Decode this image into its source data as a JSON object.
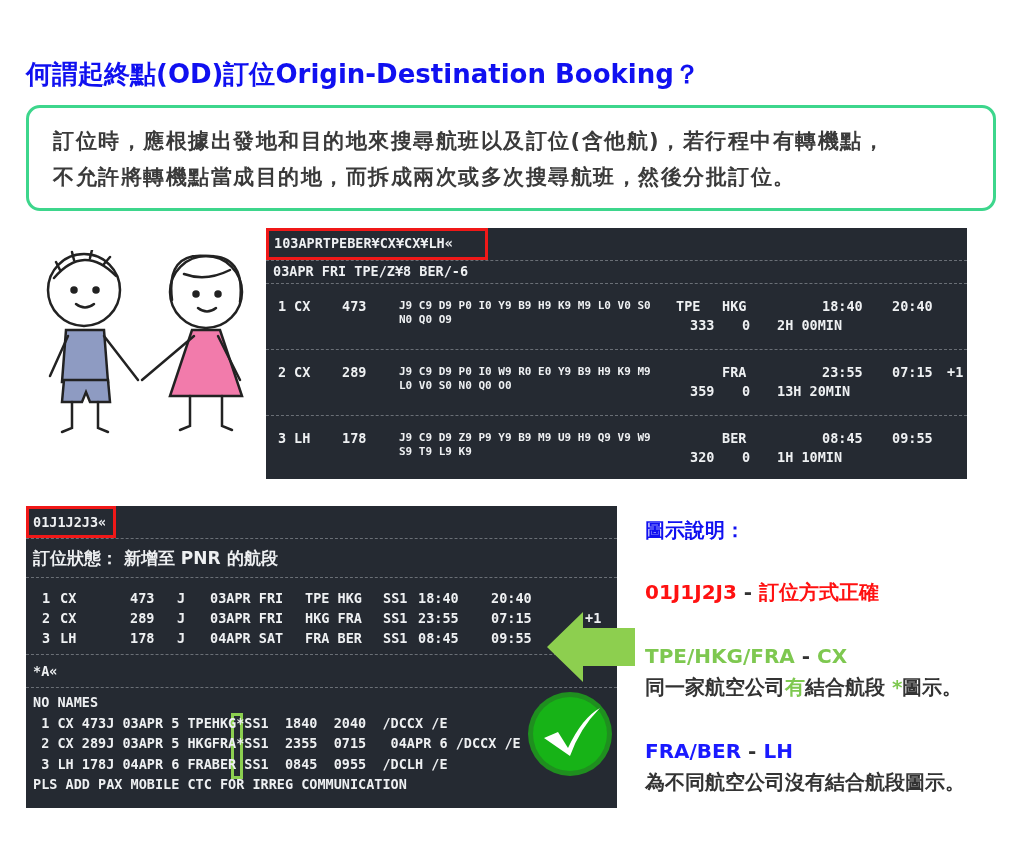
{
  "title": "何謂起終點(OD)訂位Origin-Destination Booking？",
  "intro": [
    "訂位時，應根據出發地和目的地來搜尋航班以及訂位(含他航)，若行程中有轉機點，",
    "不允許將轉機點當成目的地，而拆成兩次或多次搜尋航班，然後分批訂位。"
  ],
  "availability": {
    "command": "103APRTPEBER¥CX¥CX¥LH«",
    "header": "03APR FRI TPE/Z¥8 BER/-6",
    "flights": [
      {
        "line": "1",
        "airline": "CX",
        "flight": "473",
        "classes": [
          "J9 C9 D9 P0 I0 Y9 B9 H9 K9 M9 L0 V0 S0",
          "N0 Q0 O9"
        ],
        "from": "TPE",
        "to": "HKG",
        "depart": "18:40",
        "arrive": "20:40",
        "aircraft": "333",
        "stops": "0",
        "duration": "2H 00MIN"
      },
      {
        "line": "2",
        "airline": "CX",
        "flight": "289",
        "classes": [
          "J9 C9 D9 P0 I0 W9 R0 E0 Y9 B9 H9 K9 M9",
          "L0 V0 S0 N0 Q0 O0"
        ],
        "to": "FRA",
        "depart": "23:55",
        "arrive": "07:15",
        "day_change": "+1",
        "aircraft": "359",
        "stops": "0",
        "duration": "13H 20MIN"
      },
      {
        "line": "3",
        "airline": "LH",
        "flight": "178",
        "classes": [
          "J9 C9 D9 Z9 P9 Y9 B9 M9 U9 H9 Q9 V9 W9",
          "S9 T9 L9 K9"
        ],
        "to": "BER",
        "depart": "08:45",
        "arrive": "09:55",
        "aircraft": "320",
        "stops": "0",
        "duration": "1H 10MIN"
      }
    ]
  },
  "booking": {
    "command": "01J1J2J3«",
    "status": "訂位狀態： 新增至 PNR 的航段",
    "segments": [
      {
        "line": "1",
        "airline": "CX",
        "flight": "473",
        "class": "J",
        "date": "03APR FRI",
        "route": "TPE HKG",
        "status": "SS1",
        "depart": "18:40",
        "arrive": "20:40"
      },
      {
        "line": "2",
        "airline": "CX",
        "flight": "289",
        "class": "J",
        "date": "03APR FRI",
        "route": "HKG FRA",
        "status": "SS1",
        "depart": "23:55",
        "arrive": "07:15",
        "day_change": "+1"
      },
      {
        "line": "3",
        "airline": "LH",
        "flight": "178",
        "class": "J",
        "date": "04APR SAT",
        "route": "FRA BER",
        "status": "SS1",
        "depart": "08:45",
        "arrive": "09:55"
      }
    ],
    "display_command": "*A«",
    "names": "NO NAMES",
    "pnr_lines": [
      "1 CX 473J 03APR 5 TPEHKG*SS1  1840  2040  /DCCX /E",
      "2 CX 289J 03APR 5 HKGFRA*SS1  2355  0715   04APR 6 /DCCX /E",
      "3 LH 178J 04APR 6 FRABER SS1  0845  0955  /DCLH /E"
    ],
    "remark": "PLS ADD PAX MOBILE CTC FOR IRREG COMMUNICATION"
  },
  "legend": {
    "heading": "圖示說明：",
    "items": [
      {
        "code": "01J1J2J3",
        "separator": "-",
        "desc": "訂位方式正確",
        "color": "#ff1111"
      },
      {
        "code": "TPE/HKG/FRA",
        "separator": "-",
        "desc": "CX",
        "color": "#7ec850",
        "note": [
          {
            "text": "同一家航空公司",
            "highlight": false
          },
          {
            "text": "有",
            "highlight": true
          },
          {
            "text": "結合航段 ",
            "highlight": false
          },
          {
            "text": "*",
            "highlight": true
          },
          {
            "text": "圖示。",
            "highlight": false
          }
        ]
      },
      {
        "code": "FRA/BER",
        "separator": "-",
        "desc": "LH",
        "color": "#1a1aff",
        "note": [
          {
            "text": "為不同航空公司沒有結合航段圖示。",
            "highlight": false
          }
        ]
      }
    ]
  }
}
